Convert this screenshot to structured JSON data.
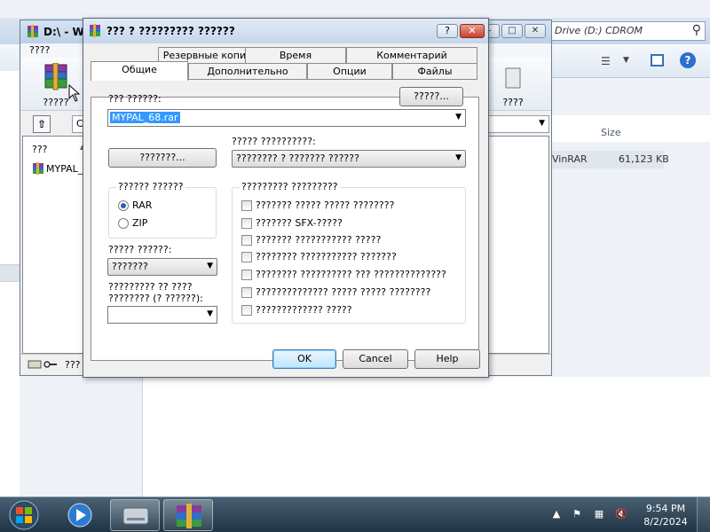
{
  "explorer": {
    "sub_label": "????",
    "address": "Drive (D:) CDROM",
    "size_header": "Size",
    "row_type": "VinRAR",
    "row_size": "61,123 KB"
  },
  "winrar": {
    "title": "D:\\ - Wi",
    "menu": "????",
    "add_tool_label": "?????",
    "right_tool_label": "????",
    "path": "C",
    "column_name": "???",
    "file_name": "MYPAL_",
    "status_text": "???"
  },
  "dialog": {
    "title": "??? ? ????????? ??????",
    "help_button": "?",
    "close_button": "✕",
    "tabs_row1": [
      "Резервные копии",
      "Время",
      "Комментарий"
    ],
    "tabs_row2": [
      "Общие",
      "Дополнительно",
      "Опции",
      "Файлы"
    ],
    "active_tab": "Общие",
    "archive_name_label": "??? ??????:",
    "browse_button": "?????...",
    "archive_name_value": "MYPAL_68.rar",
    "profiles_button": "???????...",
    "update_mode_label": "????? ??????????:",
    "update_mode_value": "???????? ? ??????? ??????",
    "format_group_title": "?????? ??????",
    "format_options": [
      "RAR",
      "ZIP"
    ],
    "selected_format": "RAR",
    "method_label": "????? ??????:",
    "method_value": "???????",
    "split_label_line1": "????????? ?? ????",
    "split_label_line2": "???????? (? ??????):",
    "split_value": "",
    "options_group_title": "????????? ?????????",
    "archive_options": [
      "??????? ????? ????? ????????",
      "??????? SFX-?????",
      "??????? ??????????? ?????",
      "???????? ??????????? ???????",
      "???????? ?????????? ??? ??????????????",
      "?????????????? ????? ????? ????????",
      "????????????? ?????"
    ],
    "ok_button": "OK",
    "cancel_button": "Cancel",
    "help_button_bottom": "Help"
  },
  "taskbar": {
    "time": "9:54 PM",
    "date": "8/2/2024",
    "tray_icons": [
      "chevron-up-icon",
      "flag-icon",
      "network-icon",
      "volume-muted-icon"
    ]
  },
  "colors": {
    "selection": "#3399ff",
    "taskbar": "#2b4354",
    "close_button": "#c8412c"
  }
}
